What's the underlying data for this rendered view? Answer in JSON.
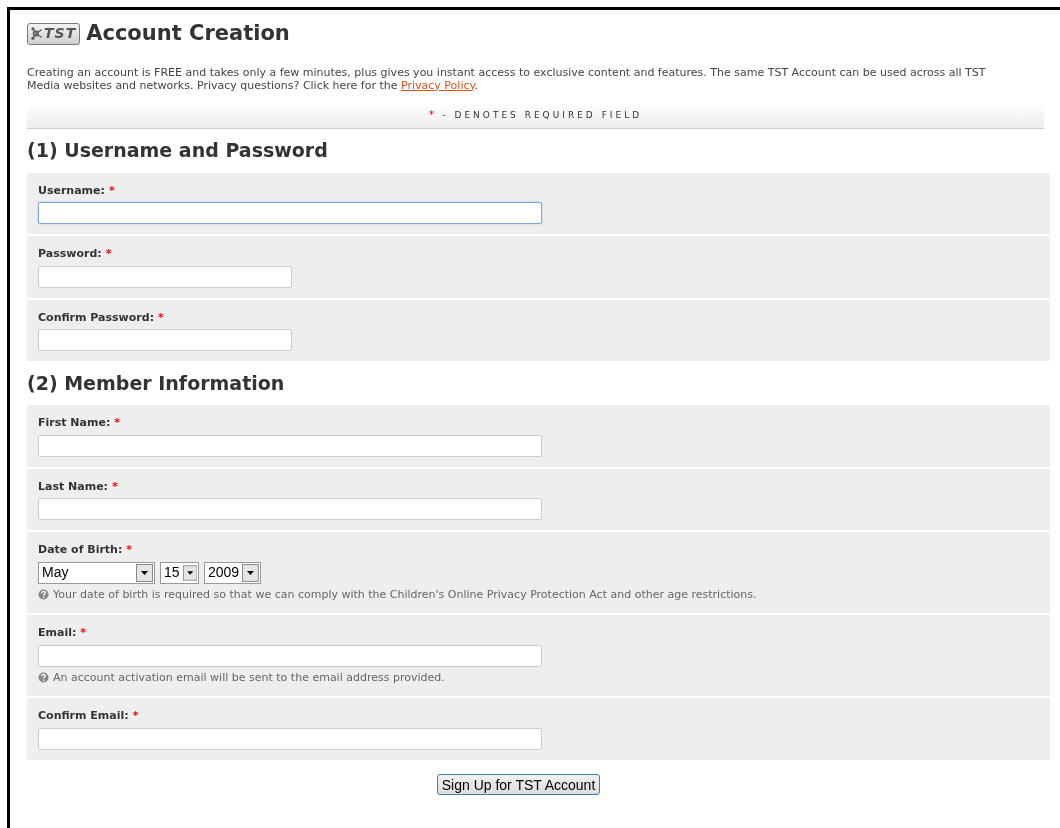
{
  "header": {
    "logo_text": "TST",
    "title": "Account Creation"
  },
  "intro": {
    "text": "Creating an account is FREE and takes only a few minutes, plus gives you instant access to exclusive content and features. The same TST Account can be used across all TST Media websites and networks. Privacy questions? Click here for the",
    "link": "Privacy Policy",
    "end": "."
  },
  "required_note": {
    "mark": "*",
    "text": "- DENOTES REQUIRED FIELD"
  },
  "sections": [
    {
      "title": "(1) Username and Password",
      "fields": [
        {
          "kind": "long_text",
          "label": "Username:",
          "mark": "*",
          "focused": true
        },
        {
          "kind": "short_text",
          "label": "Password:",
          "mark": "*",
          "focused": false
        },
        {
          "kind": "short_text",
          "label": "Confirm Password:",
          "mark": "*",
          "focused": false
        }
      ]
    },
    {
      "title": "(2) Member Information",
      "fields": [
        {
          "kind": "long_text",
          "label": "First Name:",
          "mark": "*",
          "focused": false
        },
        {
          "kind": "long_text",
          "label": "Last Name:",
          "mark": "*",
          "focused": false
        },
        {
          "kind": "date",
          "label": "Date of Birth:",
          "mark": "*",
          "selects": [
            {
              "value": "May"
            },
            {
              "value": "15"
            },
            {
              "value": "2009"
            }
          ],
          "hint": "Your date of birth is required so that we can comply with the Children's Online Privacy Protection Act and other age restrictions."
        },
        {
          "kind": "long_text",
          "label": "Email:",
          "mark": "*",
          "focused": false,
          "hint": "An account activation email will be sent to the email address provided."
        },
        {
          "kind": "long_text",
          "label": "Confirm Email:",
          "mark": "*",
          "focused": false
        }
      ]
    }
  ],
  "submit": {
    "label": "Sign Up for TST Account"
  }
}
